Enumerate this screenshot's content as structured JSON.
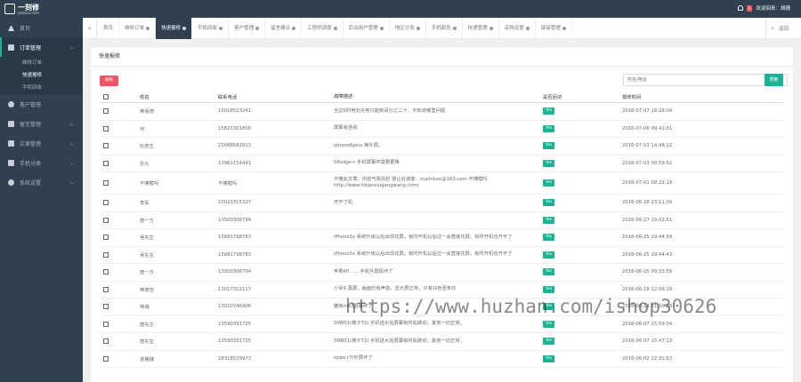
{
  "app": {
    "logo_text": "一刻修",
    "logo_sub": "yikexiu.com",
    "welcome": "欢迎回来：胡珊",
    "notify_count": "0"
  },
  "sidebar": {
    "items": [
      {
        "label": "首页",
        "icon": "home-icon"
      },
      {
        "label": "订单管理",
        "icon": "order-icon",
        "active": true
      },
      {
        "label": "客户管理",
        "icon": "user-icon"
      },
      {
        "label": "留言管理",
        "icon": "message-icon"
      },
      {
        "label": "文章管理",
        "icon": "article-icon"
      },
      {
        "label": "手机分类",
        "icon": "phone-icon"
      },
      {
        "label": "系统设置",
        "icon": "gear-icon"
      }
    ],
    "subitems": [
      "维修订单",
      "快速报修",
      "手机回收"
    ]
  },
  "tabs": [
    "首页",
    "维修订单",
    "快速报修",
    "手机回收",
    "客户管理",
    "留言建议",
    "工程师调度",
    "后台用户管理",
    "地区分类",
    "手机颜色",
    "快递管理",
    "采购设置",
    "链接管理"
  ],
  "tab_back": "返回",
  "card": {
    "title": "快速报修",
    "delete_label": "删除",
    "search_placeholder": "姓名/电话",
    "search_label": "搜索"
  },
  "table": {
    "headers": [
      "姓名",
      "联系电话",
      "故障描述",
      "是否回访",
      "报修时间"
    ],
    "rows": [
      {
        "name": "蒋佰德",
        "phone": "15018513241",
        "desc": "全边5时电池充电只能到百分之二十，不知道哪里问题",
        "visit": "Yes",
        "time": "2016-07-07 18:28:04"
      },
      {
        "name": "何",
        "phone": "15821301800",
        "desc": "屏幕有竖线",
        "visit": "Yes",
        "time": "2016-07-06 09:41:01"
      },
      {
        "name": "杜若生",
        "phone": "15088582813",
        "desc": "iphone6plus 换外屏。",
        "visit": "Yes",
        "time": "2016-07-03 14:48:22"
      },
      {
        "name": "张九",
        "phone": "13961154441",
        "desc": "S6edge+ 手机屏幕坏需要更换",
        "visit": "Yes",
        "time": "2016-07-03 00:59:52"
      },
      {
        "name": "不懂瞎吗",
        "phone": "不懂瞎吗",
        "desc": "不懂此文章，内容气氛的赶 禁止此询客：malinkan@163.com 不懂瞎吗 http://www.hibanxiugangwang.com/",
        "visit": "Yes",
        "time": "2016-07-01 08:22:19",
        "tall": true
      },
      {
        "name": "李军",
        "phone": "15023315327",
        "desc": "开不了机",
        "visit": "Yes",
        "time": "2016-06-28 23:11:34"
      },
      {
        "name": "唐一方",
        "phone": "13500306794",
        "desc": "",
        "visit": "Yes",
        "time": "2016-06-27 19:02:51"
      },
      {
        "name": "吴先生",
        "phone": "15881798783",
        "desc": "iPhone5s 系统升级以后出现花屏，有时开机以后过一会直接花屏，有时开机也开不了",
        "visit": "Yes",
        "time": "2016-06-25 19:44:59"
      },
      {
        "name": "吴先生",
        "phone": "15881798783",
        "desc": "iPhone5s 系统升级以后出现花屏，有时开机以后过一会直接花屏，有时开机也开不了",
        "visit": "Yes",
        "time": "2016-06-25 19:44:43"
      },
      {
        "name": "唐一方",
        "phone": "13500306794",
        "desc": "苹果6P…… 手机外屏摔坏了",
        "visit": "Yes",
        "time": "2016-06-25 09:33:58"
      },
      {
        "name": "蒋德浩",
        "phone": "13017312117",
        "desc": "小米4 黑屏，画面仍有声音，显示屏正常，只有白色竖条纹",
        "visit": "Yes",
        "time": "2016-06-18 12:06:19"
      },
      {
        "name": "蒋瑞",
        "phone": "13020746406",
        "desc": "魅族mx3屏幕碎了",
        "visit": "Yes",
        "time": "2016-06-14 11:50:28"
      },
      {
        "name": "唐先生",
        "phone": "13590351725",
        "desc": "SM801(楼子T2) 手机进水后屏幕有时乱跳动，其他一切正常。",
        "visit": "Yes",
        "time": "2016-06-07 15:59:34"
      },
      {
        "name": "唐先生",
        "phone": "13590351725",
        "desc": "SM801(楼子T2) 手机进水后屏幕有时乱跳动，其他一切正常。",
        "visit": "Yes",
        "time": "2016-06-07 15:47:13"
      },
      {
        "name": "苗捕捕",
        "phone": "18318539973",
        "desc": "oppo r7t外屏坏了",
        "visit": "Yes",
        "time": "2016-06-02 22:31:57"
      }
    ]
  },
  "watermark": "https://www.huzhan.com/ishop30626"
}
